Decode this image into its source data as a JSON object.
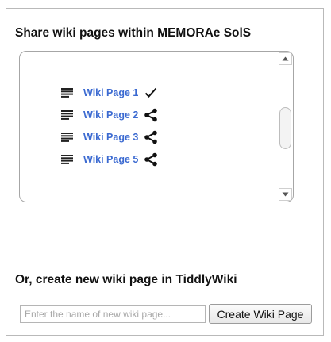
{
  "share_section": {
    "title": "Share wiki pages within MEMORAe SolS",
    "pages": [
      {
        "label": "Wiki Page 1",
        "status_icon": "check-icon"
      },
      {
        "label": "Wiki Page 2",
        "status_icon": "share-icon"
      },
      {
        "label": "Wiki Page 3",
        "status_icon": "share-icon"
      },
      {
        "label": "Wiki Page 5",
        "status_icon": "share-icon"
      }
    ],
    "page_icon": "document-lines-icon"
  },
  "create_section": {
    "title": "Or, create new wiki page in TiddlyWiki",
    "input_placeholder": "Enter the name of new wiki page...",
    "input_value": "",
    "button_label": "Create Wiki Page"
  },
  "colors": {
    "link": "#3b6ad1",
    "border": "#b9b9b9",
    "text": "#111111"
  }
}
